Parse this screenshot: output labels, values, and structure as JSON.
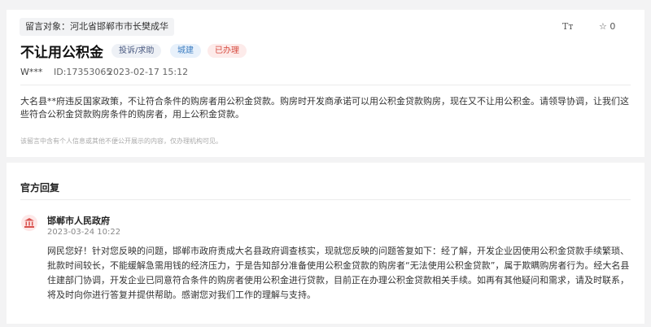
{
  "message": {
    "target_label": "留言对象：河北省邯郸市市长樊成华",
    "title": "不让用公积金",
    "badges": {
      "category": "投诉/求助",
      "department": "城建",
      "status": "已办理"
    },
    "user": "W***",
    "id_text": "ID:17353065",
    "time": "2023-02-17 15:12",
    "toolbar": {
      "font_size_icon": "Tт",
      "like_count": "0"
    },
    "content": "大名县**府违反国家政策，不让符合条件的购房者用公积金贷款。购房时开发商承诺可以用公积金贷款购房，现在又不让用公积金。请领导协调，让我们这些符合公积金贷款购房条件的购房者，用上公积金贷款。",
    "privacy_notice": "该留言中含有个人信息或其他不便公开展示的内容，仅办理机构可见。"
  },
  "reply": {
    "section_title": "官方回复",
    "org_name": "邯郸市人民政府",
    "time": "2023-03-24 10:22",
    "content": "网民您好！针对您反映的问题，邯郸市政府责成大名县政府调查核实，现就您反映的问题答复如下：经了解，开发企业因使用公积金贷款手续繁琐、批款时间较长，不能缓解急需用钱的经济压力，于是告知部分准备使用公积金贷款的购房者“无法使用公积金贷款”，属于欺瞒购房者行为。经大名县住建部门协调，开发企业已同意符合条件的购房者使用公积金进行贷款，目前正在办理公积金贷款相关手续。如再有其他疑问和需求，请及时联系，将及时向你进行答复并提供帮助。感谢您对我们工作的理解与支持。"
  },
  "colors": {
    "status_red": "#d64a3e",
    "dept_blue": "#3f7fc2",
    "category_navy": "#4a5a80"
  }
}
